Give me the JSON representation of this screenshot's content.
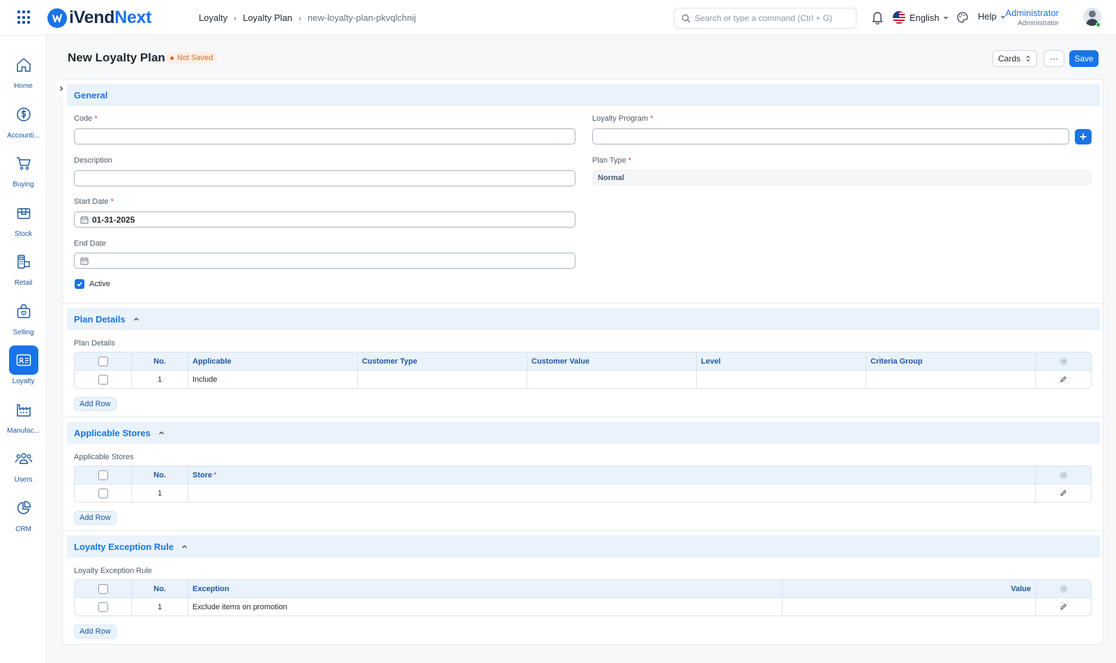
{
  "app": {
    "logo_part1": "iVend",
    "logo_part2": "Next"
  },
  "breadcrumb": {
    "items": [
      "Loyalty",
      "Loyalty Plan"
    ],
    "current": "new-loyalty-plan-pkvqlchnij"
  },
  "search": {
    "placeholder": "Search or type a command (Ctrl + G)"
  },
  "header": {
    "language": "English",
    "help": "Help",
    "user_name": "Administrator",
    "user_role": "Administrator"
  },
  "sidebar": {
    "items": [
      {
        "label": "Home",
        "icon": "home-icon"
      },
      {
        "label": "Accounti...",
        "icon": "dollar-icon"
      },
      {
        "label": "Buying",
        "icon": "cart-icon"
      },
      {
        "label": "Stock",
        "icon": "box-icon"
      },
      {
        "label": "Retail",
        "icon": "pos-icon"
      },
      {
        "label": "Selling",
        "icon": "shopping-bag-icon"
      },
      {
        "label": "Loyalty",
        "icon": "id-card-icon",
        "active": true
      },
      {
        "label": "Manufac...",
        "icon": "factory-icon"
      },
      {
        "label": "Users",
        "icon": "users-icon"
      },
      {
        "label": "CRM",
        "icon": "pie-chart-icon"
      }
    ]
  },
  "page": {
    "title": "New Loyalty Plan",
    "status": "Not Saved",
    "view_label": "Cards",
    "more_label": "···",
    "save_label": "Save"
  },
  "general": {
    "title": "General",
    "code_label": "Code",
    "code_value": "",
    "description_label": "Description",
    "description_value": "",
    "start_date_label": "Start Date",
    "start_date_value": "01-31-2025",
    "end_date_label": "End Date",
    "end_date_value": "",
    "active_label": "Active",
    "active_checked": true,
    "loyalty_program_label": "Loyalty Program",
    "loyalty_program_value": "",
    "plan_type_label": "Plan Type",
    "plan_type_value": "Normal"
  },
  "plan_details": {
    "title": "Plan Details",
    "table_label": "Plan Details",
    "columns": [
      "No.",
      "Applicable",
      "Customer Type",
      "Customer Value",
      "Level",
      "Criteria Group"
    ],
    "rows": [
      {
        "no": "1",
        "applicable": "Include",
        "customer_type": "",
        "customer_value": "",
        "level": "",
        "criteria_group": ""
      }
    ],
    "add_row": "Add Row"
  },
  "applicable_stores": {
    "title": "Applicable Stores",
    "table_label": "Applicable Stores",
    "columns": [
      "No.",
      "Store"
    ],
    "rows": [
      {
        "no": "1",
        "store": ""
      }
    ],
    "add_row": "Add Row"
  },
  "exception_rule": {
    "title": "Loyalty Exception Rule",
    "table_label": "Loyalty Exception Rule",
    "columns": [
      "No.",
      "Exception",
      "Value"
    ],
    "rows": [
      {
        "no": "1",
        "exception": "Exclude items on promotion",
        "value": ""
      }
    ],
    "add_row": "Add Row"
  },
  "colors": {
    "accent": "#1a73e8",
    "section_bg": "#eaf3fc",
    "badge_text": "#e0652b",
    "required": "#e03636"
  }
}
